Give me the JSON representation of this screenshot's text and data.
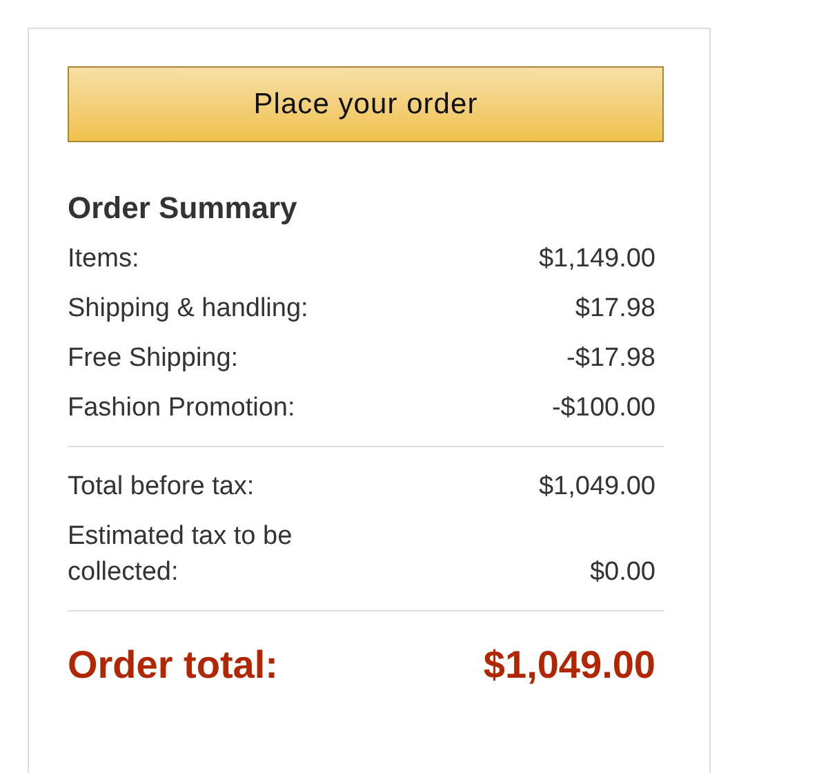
{
  "order_button": {
    "label": "Place your order"
  },
  "summary": {
    "title": "Order Summary",
    "lines": [
      {
        "label": "Items:",
        "amount": "$1,149.00"
      },
      {
        "label": "Shipping & handling:",
        "amount": "$17.98"
      },
      {
        "label": "Free Shipping:",
        "amount": "-$17.98"
      },
      {
        "label": "Fashion Promotion:",
        "amount": "-$100.00"
      }
    ],
    "subtotals": [
      {
        "label": "Total before tax:",
        "amount": "$1,049.00"
      },
      {
        "label": "Estimated tax to be collected:",
        "amount": "$0.00"
      }
    ],
    "total": {
      "label": "Order total:",
      "amount": "$1,049.00"
    }
  }
}
